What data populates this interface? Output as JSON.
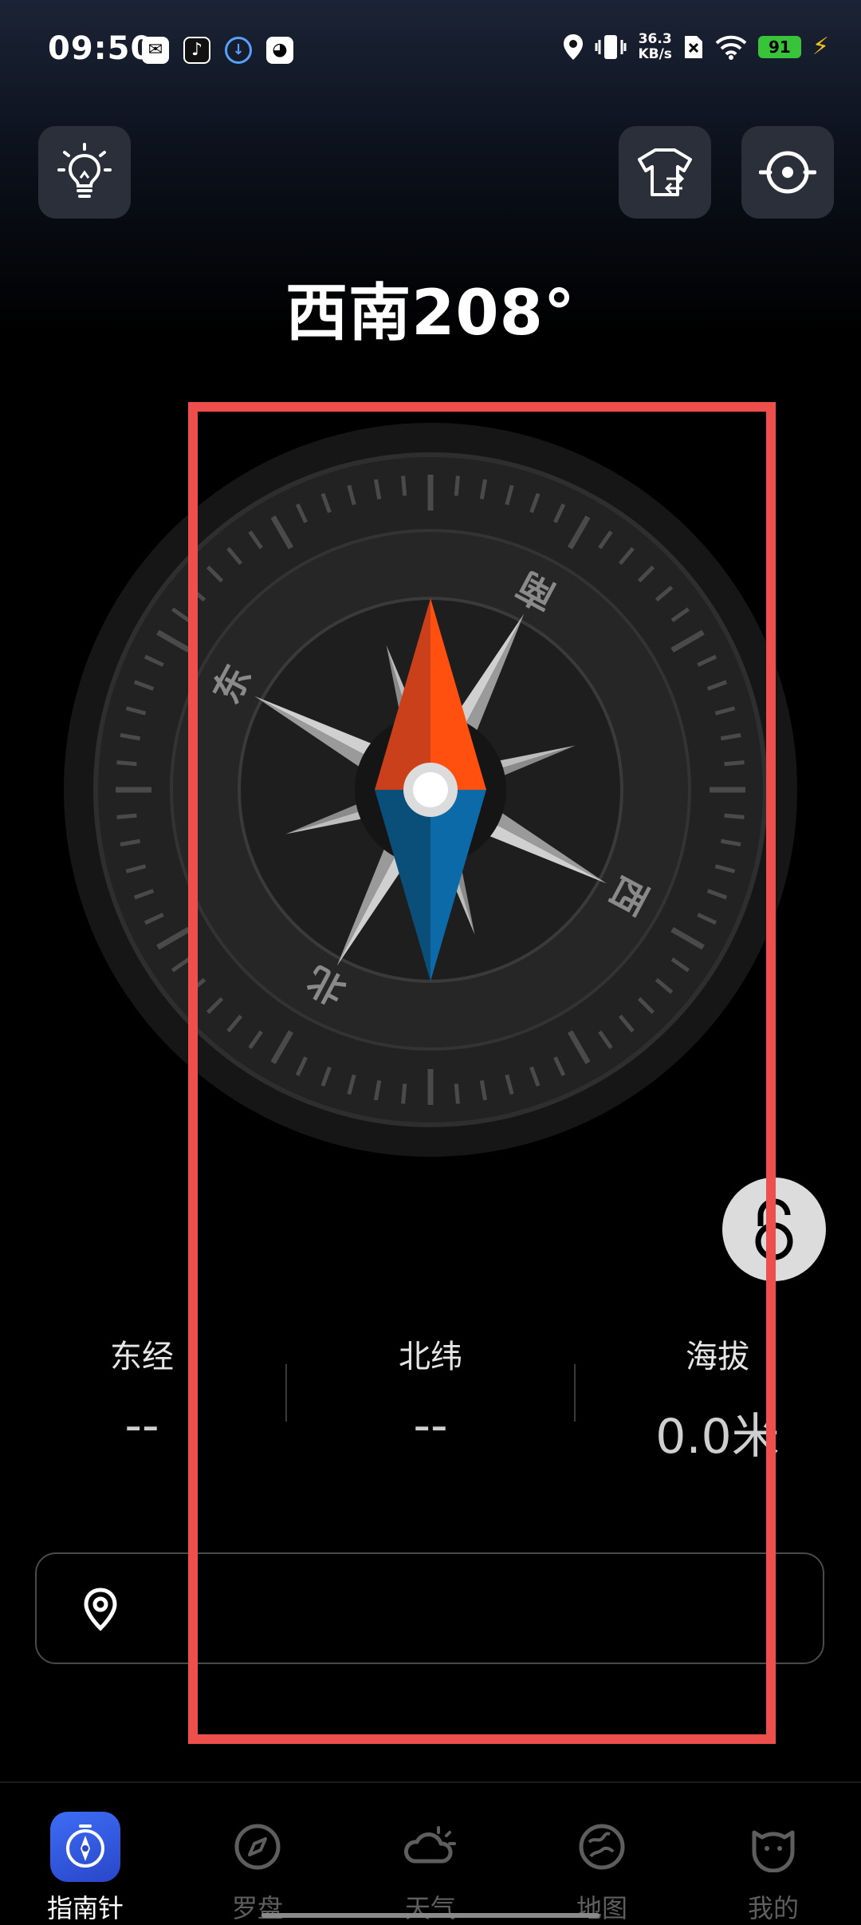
{
  "status_bar": {
    "time": "09:50",
    "notification_icons": [
      "mail-icon",
      "tiktok-icon",
      "download-icon",
      "cat-app-icon"
    ],
    "net_speed_value": "36.3",
    "net_speed_unit": "KB/s",
    "battery": "91"
  },
  "heading": "西南208°",
  "compass": {
    "labels": {
      "south": "南",
      "west": "西",
      "north": "北",
      "east": "东"
    },
    "heading_degrees": 208,
    "colors": {
      "needle_north": "#ff5010",
      "needle_south": "#0c6aa8"
    }
  },
  "info": {
    "longitude_label": "东经",
    "longitude_value": "--",
    "latitude_label": "北纬",
    "latitude_value": "--",
    "altitude_label": "海拔",
    "altitude_value": "0.0米"
  },
  "location_bar": {
    "text": ""
  },
  "nav": {
    "items": [
      {
        "label": "指南针",
        "icon": "compass-icon"
      },
      {
        "label": "罗盘",
        "icon": "dial-icon"
      },
      {
        "label": "天气",
        "icon": "weather-icon"
      },
      {
        "label": "地图",
        "icon": "map-icon"
      },
      {
        "label": "我的",
        "icon": "profile-icon"
      }
    ]
  },
  "colors": {
    "accent": "#3c6df5",
    "highlight_box": "#ee4e4c"
  }
}
